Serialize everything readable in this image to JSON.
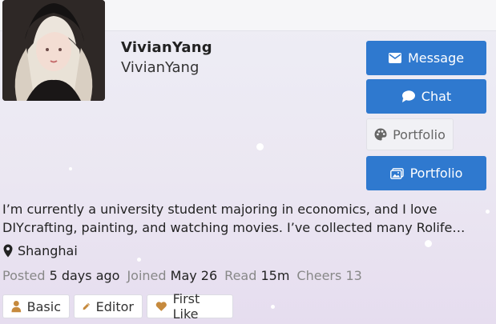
{
  "profile": {
    "display_name": "VivianYang",
    "username": "VivianYang",
    "bio": "I’m currently a university student majoring in economics, and I love DIYcrafting, painting, and watching movies. I’ve collected many Rolife…",
    "location": "Shanghai"
  },
  "actions": {
    "message_label": "Message",
    "chat_label": "Chat",
    "portfolio_light_label": "Portfolio",
    "portfolio_label": "Portfolio"
  },
  "meta": {
    "posted_label": "Posted",
    "posted_value": "5 days ago",
    "joined_label": "Joined",
    "joined_value": "May 26",
    "read_label": "Read",
    "read_value": "15m",
    "cheers_label": "Cheers",
    "cheers_value": "13"
  },
  "badges": [
    {
      "label": "Basic",
      "icon": "user-icon"
    },
    {
      "label": "Editor",
      "icon": "pencil-icon"
    },
    {
      "label": "First Like",
      "icon": "heart-icon"
    }
  ],
  "colors": {
    "primary_button": "#2f79cf",
    "badge_icon": "#c68a3e"
  }
}
